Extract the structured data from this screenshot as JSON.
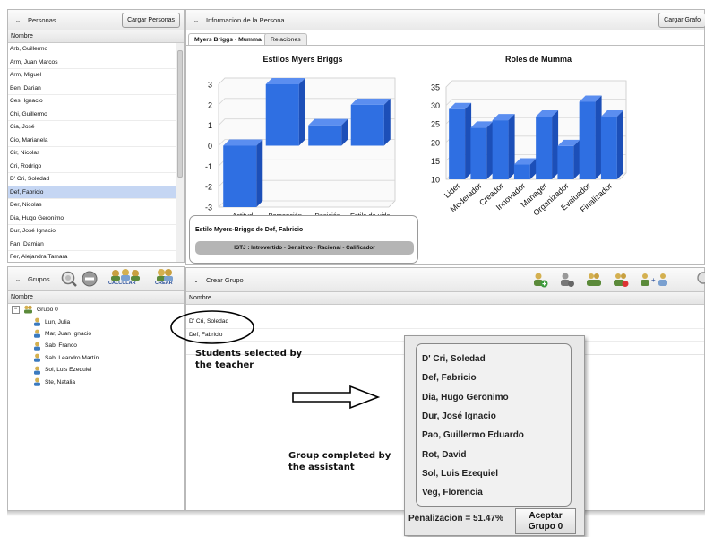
{
  "personas": {
    "title": "Personas",
    "load_button": "Cargar Personas",
    "column": "Nombre",
    "rows": [
      "Arb, Guillermo",
      "Arm, Juan Marcos",
      "Arm, Miguel",
      "Ben, Darian",
      "Ces, Ignacio",
      "Chi, Guillermo",
      "Cia, José",
      "Cio, Marianela",
      "Cir, Nicolas",
      "Cri, Rodrigo",
      "D' Cri, Soledad",
      "Def, Fabricio",
      "Der, Nicolas",
      "Dia, Hugo Geronimo",
      "Dur, José Ignacio",
      "Fan, Damián",
      "Fer, Alejandra Tamara",
      "Gar, Nicolas"
    ],
    "selected_index": 11
  },
  "info": {
    "title": "Informacion de la Persona",
    "load_button": "Cargar Grafo",
    "tabs": [
      "Myers Briggs - Mumma",
      "Relaciones"
    ],
    "mb_box_title": "Estilo Myers-Briggs de Def, Fabricio",
    "mb_box_value": "ISTJ : Introvertido - Sensitivo - Racional - Calificador"
  },
  "chart_data": [
    {
      "type": "bar",
      "title": "Estilos Myers Briggs",
      "categories": [
        "Actitud",
        "Percepción",
        "Desición",
        "Estilo de vida"
      ],
      "values": [
        -3,
        3,
        1,
        2
      ],
      "ylim": [
        -3,
        3
      ],
      "yticks": [
        3,
        2,
        1,
        0,
        -1,
        -2,
        -3
      ],
      "bar_color": "#2f6fe2"
    },
    {
      "type": "bar",
      "title": "Roles de Mumma",
      "categories": [
        "Lider",
        "Moderador",
        "Creador",
        "Innovador",
        "Manager",
        "Organizador",
        "Evaluador",
        "Finalizador"
      ],
      "values": [
        29,
        24,
        26,
        14,
        27,
        19,
        31,
        27
      ],
      "ylim": [
        10,
        35
      ],
      "yticks": [
        35,
        30,
        25,
        20,
        15,
        10
      ],
      "bar_color": "#2f6fe2"
    }
  ],
  "grupos": {
    "title": "Grupos",
    "column": "Nombre",
    "calc_label": "CALCULAR",
    "create_label": "CREAR",
    "group_name": "Grupo 0",
    "members": [
      "Lun, Julia",
      "Mar, Juan Ignacio",
      "Sab, Franco",
      "Sab, Leandro Martín",
      "Sol, Luis Ezequiel",
      "Ste, Natalia"
    ]
  },
  "crear": {
    "title": "Crear Grupo",
    "column": "Nombre",
    "rows": [
      "D' Cri, Soledad",
      "Def, Fabricio"
    ]
  },
  "annotations": {
    "students_note": "Students selected by the teacher",
    "group_note": "Group completed by the assistant"
  },
  "popup": {
    "names": [
      "D' Cri, Soledad",
      "Def, Fabricio",
      "Dia, Hugo Geronimo",
      "Dur, José Ignacio",
      "Pao, Guillermo Eduardo",
      "Rot, David",
      "Sol, Luis Ezequiel",
      "Veg, Florencia"
    ],
    "penalty": "Penalizacion = 51.47%",
    "accept_label": "Aceptar Grupo 0"
  },
  "colors": {
    "selection": "#c5d6f3",
    "bar": "#2f6fe2",
    "bar_side": "#1c4fb8",
    "bar_top": "#5b8ef0"
  }
}
